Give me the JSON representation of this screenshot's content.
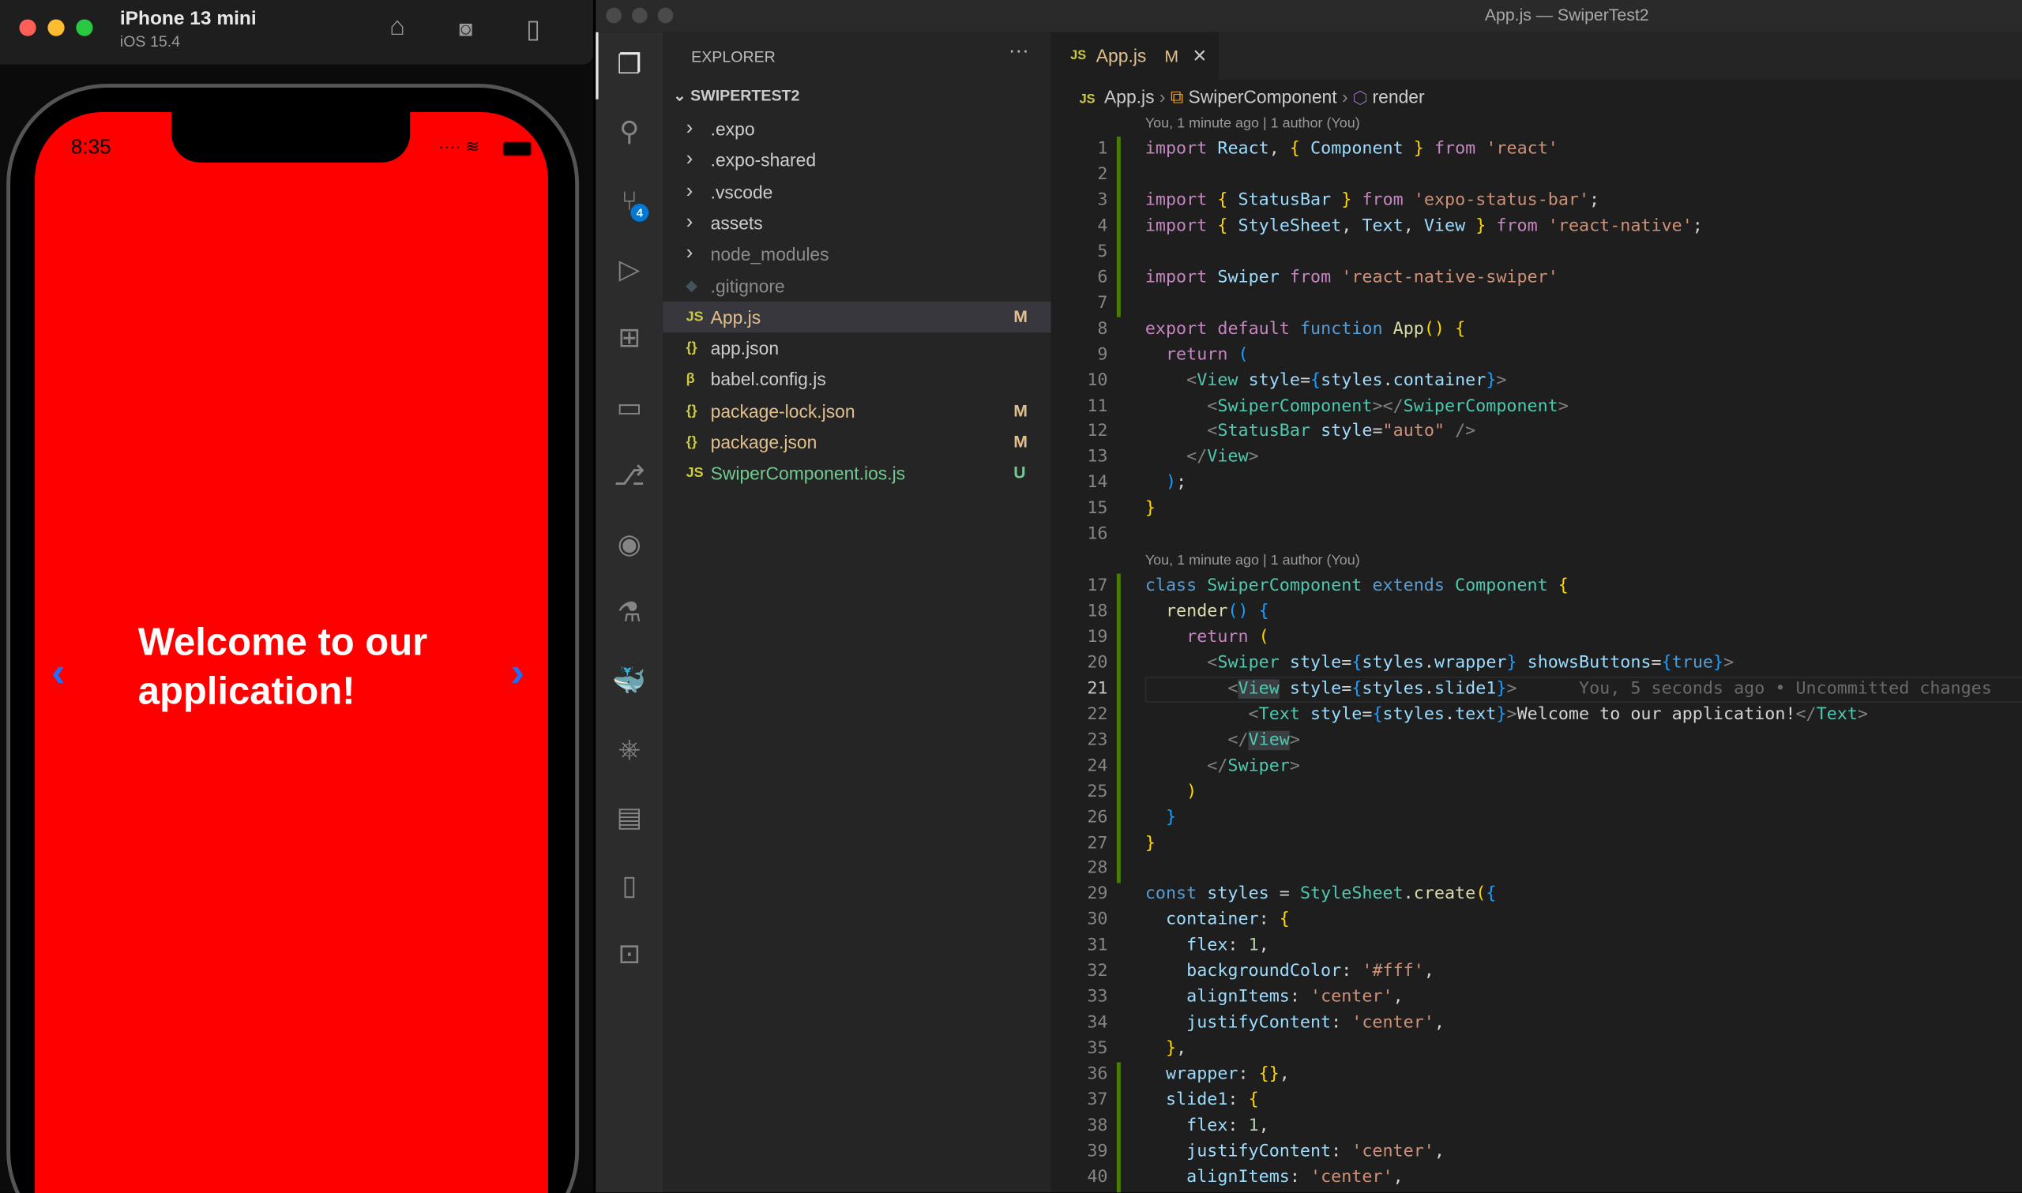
{
  "simulator": {
    "device": "iPhone 13 mini",
    "os": "iOS 15.4",
    "icons": [
      "home-icon",
      "screenshot-icon",
      "rotate-icon"
    ],
    "time": "8:35",
    "welcome": "Welcome to our application!",
    "prev": "‹",
    "next": "›"
  },
  "window": {
    "title": "App.js — SwiperTest2"
  },
  "activity": {
    "badge": "4"
  },
  "explorer": {
    "label": "EXPLORER",
    "more": "···",
    "project": "SWIPERTEST2",
    "items": [
      {
        "name": ".expo",
        "type": "folder",
        "icon": "›",
        "color": "#cccccc",
        "status": ""
      },
      {
        "name": ".expo-shared",
        "type": "folder",
        "icon": "›",
        "color": "#cccccc",
        "status": ""
      },
      {
        "name": ".vscode",
        "type": "folder",
        "icon": "›",
        "color": "#cccccc",
        "status": ""
      },
      {
        "name": "assets",
        "type": "folder",
        "icon": "›",
        "color": "#cccccc",
        "status": ""
      },
      {
        "name": "node_modules",
        "type": "folder",
        "icon": "›",
        "color": "#8c8c8c",
        "status": ""
      },
      {
        "name": ".gitignore",
        "type": "file",
        "icon": "◆",
        "color": "#8c8c8c",
        "status": ""
      },
      {
        "name": "App.js",
        "type": "file",
        "icon": "JS",
        "color": "#e2c08d",
        "status": "M"
      },
      {
        "name": "app.json",
        "type": "file",
        "icon": "{}",
        "color": "#cccccc",
        "status": ""
      },
      {
        "name": "babel.config.js",
        "type": "file",
        "icon": "β",
        "color": "#cccccc",
        "status": ""
      },
      {
        "name": "package-lock.json",
        "type": "file",
        "icon": "{}",
        "color": "#e2c08d",
        "status": "M"
      },
      {
        "name": "package.json",
        "type": "file",
        "icon": "{}",
        "color": "#e2c08d",
        "status": "M"
      },
      {
        "name": "SwiperComponent.ios.js",
        "type": "file",
        "icon": "JS",
        "color": "#73c991",
        "status": "U"
      }
    ]
  },
  "tab": {
    "icon": "JS",
    "name": "App.js",
    "status": "M",
    "close": "×"
  },
  "breadcrumb": [
    "App.js",
    "SwiperComponent",
    "render"
  ],
  "codelens": [
    "You, 1 minute ago | 1 author (You)",
    "You, 1 minute ago | 1 author (You)"
  ],
  "blame": "You, 5 seconds ago • Uncommitted changes",
  "current_line": 21,
  "code": [
    [
      [
        "k",
        "import"
      ],
      [
        "p",
        " "
      ],
      [
        "v",
        "React"
      ],
      [
        "p",
        ", "
      ],
      [
        "y",
        "{"
      ],
      [
        "p",
        " "
      ],
      [
        "v",
        "Component"
      ],
      [
        "p",
        " "
      ],
      [
        "y",
        "}"
      ],
      [
        "p",
        " "
      ],
      [
        "k",
        "from"
      ],
      [
        "p",
        " "
      ],
      [
        "s",
        "'react'"
      ]
    ],
    [],
    [
      [
        "k",
        "import"
      ],
      [
        "p",
        " "
      ],
      [
        "y",
        "{"
      ],
      [
        "p",
        " "
      ],
      [
        "v",
        "StatusBar"
      ],
      [
        "p",
        " "
      ],
      [
        "y",
        "}"
      ],
      [
        "p",
        " "
      ],
      [
        "k",
        "from"
      ],
      [
        "p",
        " "
      ],
      [
        "s",
        "'expo-status-bar'"
      ],
      [
        "p",
        ";"
      ]
    ],
    [
      [
        "k",
        "import"
      ],
      [
        "p",
        " "
      ],
      [
        "y",
        "{"
      ],
      [
        "p",
        " "
      ],
      [
        "v",
        "StyleSheet"
      ],
      [
        "p",
        ", "
      ],
      [
        "v",
        "Text"
      ],
      [
        "p",
        ", "
      ],
      [
        "v",
        "View"
      ],
      [
        "p",
        " "
      ],
      [
        "y",
        "}"
      ],
      [
        "p",
        " "
      ],
      [
        "k",
        "from"
      ],
      [
        "p",
        " "
      ],
      [
        "s",
        "'react-native'"
      ],
      [
        "p",
        ";"
      ]
    ],
    [],
    [
      [
        "k",
        "import"
      ],
      [
        "p",
        " "
      ],
      [
        "v",
        "Swiper"
      ],
      [
        "p",
        " "
      ],
      [
        "k",
        "from"
      ],
      [
        "p",
        " "
      ],
      [
        "s",
        "'react-native-swiper'"
      ]
    ],
    [],
    [
      [
        "k",
        "export"
      ],
      [
        "p",
        " "
      ],
      [
        "k",
        "default"
      ],
      [
        "p",
        " "
      ],
      [
        "b",
        "function"
      ],
      [
        "p",
        " "
      ],
      [
        "f",
        "App"
      ],
      [
        "y",
        "()"
      ],
      [
        "p",
        " "
      ],
      [
        "y",
        "{"
      ]
    ],
    [
      [
        "p",
        "  "
      ],
      [
        "k",
        "return"
      ],
      [
        "p",
        " "
      ],
      [
        "d",
        "("
      ]
    ],
    [
      [
        "p",
        "    "
      ],
      [
        "g",
        "<"
      ],
      [
        "t",
        "View"
      ],
      [
        "p",
        " "
      ],
      [
        "v",
        "style"
      ],
      [
        "p",
        "="
      ],
      [
        "d",
        "{"
      ],
      [
        "v",
        "styles"
      ],
      [
        "p",
        "."
      ],
      [
        "v",
        "container"
      ],
      [
        "d",
        "}"
      ],
      [
        "g",
        ">"
      ]
    ],
    [
      [
        "p",
        "      "
      ],
      [
        "g",
        "<"
      ],
      [
        "t",
        "SwiperComponent"
      ],
      [
        "g",
        "></"
      ],
      [
        "t",
        "SwiperComponent"
      ],
      [
        "g",
        ">"
      ]
    ],
    [
      [
        "p",
        "      "
      ],
      [
        "g",
        "<"
      ],
      [
        "t",
        "StatusBar"
      ],
      [
        "p",
        " "
      ],
      [
        "v",
        "style"
      ],
      [
        "p",
        "="
      ],
      [
        "s",
        "\"auto\""
      ],
      [
        "p",
        " "
      ],
      [
        "g",
        "/>"
      ]
    ],
    [
      [
        "p",
        "    "
      ],
      [
        "g",
        "</"
      ],
      [
        "t",
        "View"
      ],
      [
        "g",
        ">"
      ]
    ],
    [
      [
        "p",
        "  "
      ],
      [
        "d",
        ")"
      ],
      [
        "p",
        ";"
      ]
    ],
    [
      [
        "y",
        "}"
      ]
    ],
    [],
    [
      [
        "b",
        "class"
      ],
      [
        "p",
        " "
      ],
      [
        "t",
        "SwiperComponent"
      ],
      [
        "p",
        " "
      ],
      [
        "b",
        "extends"
      ],
      [
        "p",
        " "
      ],
      [
        "t",
        "Component"
      ],
      [
        "p",
        " "
      ],
      [
        "y",
        "{"
      ]
    ],
    [
      [
        "p",
        "  "
      ],
      [
        "f",
        "render"
      ],
      [
        "d",
        "()"
      ],
      [
        "p",
        " "
      ],
      [
        "d",
        "{"
      ]
    ],
    [
      [
        "p",
        "    "
      ],
      [
        "k",
        "return"
      ],
      [
        "p",
        " "
      ],
      [
        "y",
        "("
      ]
    ],
    [
      [
        "p",
        "      "
      ],
      [
        "g",
        "<"
      ],
      [
        "t",
        "Swiper"
      ],
      [
        "p",
        " "
      ],
      [
        "v",
        "style"
      ],
      [
        "p",
        "="
      ],
      [
        "d",
        "{"
      ],
      [
        "v",
        "styles"
      ],
      [
        "p",
        "."
      ],
      [
        "v",
        "wrapper"
      ],
      [
        "d",
        "}"
      ],
      [
        "p",
        " "
      ],
      [
        "v",
        "showsButtons"
      ],
      [
        "p",
        "="
      ],
      [
        "d",
        "{"
      ],
      [
        "b",
        "true"
      ],
      [
        "d",
        "}"
      ],
      [
        "g",
        ">"
      ]
    ],
    [
      [
        "p",
        "        "
      ],
      [
        "g",
        "<"
      ],
      [
        "t hl",
        "View"
      ],
      [
        "p",
        " "
      ],
      [
        "v",
        "style"
      ],
      [
        "p",
        "="
      ],
      [
        "d",
        "{"
      ],
      [
        "v",
        "styles"
      ],
      [
        "p",
        "."
      ],
      [
        "v",
        "slide1"
      ],
      [
        "d",
        "}"
      ],
      [
        "g",
        ">"
      ]
    ],
    [
      [
        "p",
        "          "
      ],
      [
        "g",
        "<"
      ],
      [
        "t",
        "Text"
      ],
      [
        "p",
        " "
      ],
      [
        "v",
        "style"
      ],
      [
        "p",
        "="
      ],
      [
        "d",
        "{"
      ],
      [
        "v",
        "styles"
      ],
      [
        "p",
        "."
      ],
      [
        "v",
        "text"
      ],
      [
        "d",
        "}"
      ],
      [
        "g",
        ">"
      ],
      [
        "p",
        "Welcome to our application!"
      ],
      [
        "g",
        "</"
      ],
      [
        "t",
        "Text"
      ],
      [
        "g",
        ">"
      ]
    ],
    [
      [
        "p",
        "        "
      ],
      [
        "g",
        "</"
      ],
      [
        "t hl",
        "View"
      ],
      [
        "g",
        ">"
      ]
    ],
    [
      [
        "p",
        "      "
      ],
      [
        "g",
        "</"
      ],
      [
        "t",
        "Swiper"
      ],
      [
        "g",
        ">"
      ]
    ],
    [
      [
        "p",
        "    "
      ],
      [
        "y",
        ")"
      ]
    ],
    [
      [
        "p",
        "  "
      ],
      [
        "d",
        "}"
      ]
    ],
    [
      [
        "y",
        "}"
      ]
    ],
    [],
    [
      [
        "b",
        "const"
      ],
      [
        "p",
        " "
      ],
      [
        "v",
        "styles"
      ],
      [
        "p",
        " = "
      ],
      [
        "t",
        "StyleSheet"
      ],
      [
        "p",
        "."
      ],
      [
        "f",
        "create"
      ],
      [
        "y",
        "("
      ],
      [
        "d",
        "{"
      ]
    ],
    [
      [
        "p",
        "  "
      ],
      [
        "v",
        "container"
      ],
      [
        "p",
        ": "
      ],
      [
        "y",
        "{"
      ]
    ],
    [
      [
        "p",
        "    "
      ],
      [
        "v",
        "flex"
      ],
      [
        "p",
        ": "
      ],
      [
        "n",
        "1"
      ],
      [
        "p",
        ","
      ]
    ],
    [
      [
        "p",
        "    "
      ],
      [
        "v",
        "backgroundColor"
      ],
      [
        "p",
        ": "
      ],
      [
        "s",
        "'#fff'"
      ],
      [
        "p",
        ","
      ]
    ],
    [
      [
        "p",
        "    "
      ],
      [
        "v",
        "alignItems"
      ],
      [
        "p",
        ": "
      ],
      [
        "s",
        "'center'"
      ],
      [
        "p",
        ","
      ]
    ],
    [
      [
        "p",
        "    "
      ],
      [
        "v",
        "justifyContent"
      ],
      [
        "p",
        ": "
      ],
      [
        "s",
        "'center'"
      ],
      [
        "p",
        ","
      ]
    ],
    [
      [
        "p",
        "  "
      ],
      [
        "y",
        "}"
      ],
      [
        "p",
        ","
      ]
    ],
    [
      [
        "p",
        "  "
      ],
      [
        "v",
        "wrapper"
      ],
      [
        "p",
        ": "
      ],
      [
        "y",
        "{}"
      ],
      [
        "p",
        ","
      ]
    ],
    [
      [
        "p",
        "  "
      ],
      [
        "v",
        "slide1"
      ],
      [
        "p",
        ": "
      ],
      [
        "y",
        "{"
      ]
    ],
    [
      [
        "p",
        "    "
      ],
      [
        "v",
        "flex"
      ],
      [
        "p",
        ": "
      ],
      [
        "n",
        "1"
      ],
      [
        "p",
        ","
      ]
    ],
    [
      [
        "p",
        "    "
      ],
      [
        "v",
        "justifyContent"
      ],
      [
        "p",
        ": "
      ],
      [
        "s",
        "'center'"
      ],
      [
        "p",
        ","
      ]
    ],
    [
      [
        "p",
        "    "
      ],
      [
        "v",
        "alignItems"
      ],
      [
        "p",
        ": "
      ],
      [
        "s",
        "'center'"
      ],
      [
        "p",
        ","
      ]
    ]
  ]
}
